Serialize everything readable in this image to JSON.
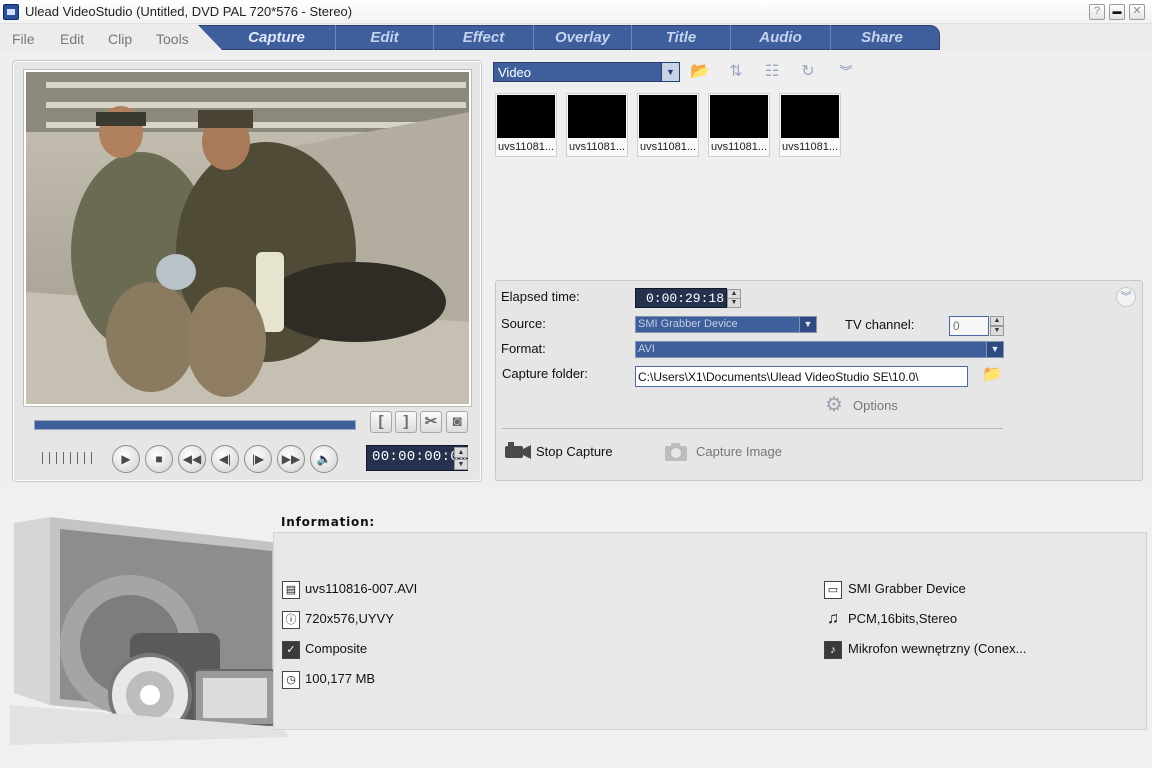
{
  "window": {
    "title": "Ulead VideoStudio (Untitled, DVD PAL 720*576 - Stereo)",
    "help_label": "?",
    "minimize_label": "▬",
    "close_label": "✕"
  },
  "menu": {
    "file": "File",
    "edit": "Edit",
    "clip": "Clip",
    "tools": "Tools"
  },
  "steps": [
    "Capture",
    "Edit",
    "Effect",
    "Overlay",
    "Title",
    "Audio",
    "Share"
  ],
  "preview": {
    "timecode": "00:00:00:00",
    "mark_in_label": "[",
    "mark_out_label": "]",
    "scrub_progress": 1.0
  },
  "library": {
    "selected": "Video",
    "clips": [
      "uvs11081...",
      "uvs11081...",
      "uvs11081...",
      "uvs11081...",
      "uvs11081..."
    ]
  },
  "capture_options": {
    "elapsed_label": "Elapsed time:",
    "elapsed_value": "0:00:29:18",
    "source_label": "Source:",
    "source_value": "SMI Grabber Device",
    "tv_channel_label": "TV channel:",
    "tv_channel_value": "0",
    "format_label": "Format:",
    "format_value": "AVI",
    "folder_label": "Capture folder:",
    "folder_value": "C:\\Users\\X1\\Documents\\Ulead VideoStudio SE\\10.0\\",
    "options_label": "Options",
    "stop_capture_label": "Stop Capture",
    "capture_image_label": "Capture Image"
  },
  "information": {
    "header": "Information:",
    "file_name": "uvs110816-007.AVI",
    "video_format": "720x576,UYVY",
    "input_type": "Composite",
    "disk_space": "100,177 MB",
    "device": "SMI Grabber Device",
    "audio_format": "PCM,16bits,Stereo",
    "audio_device": "Mikrofon wewnętrzny (Conex..."
  },
  "colors": {
    "accent": "#3f5e9c",
    "timecode_bg": "#24324f"
  }
}
